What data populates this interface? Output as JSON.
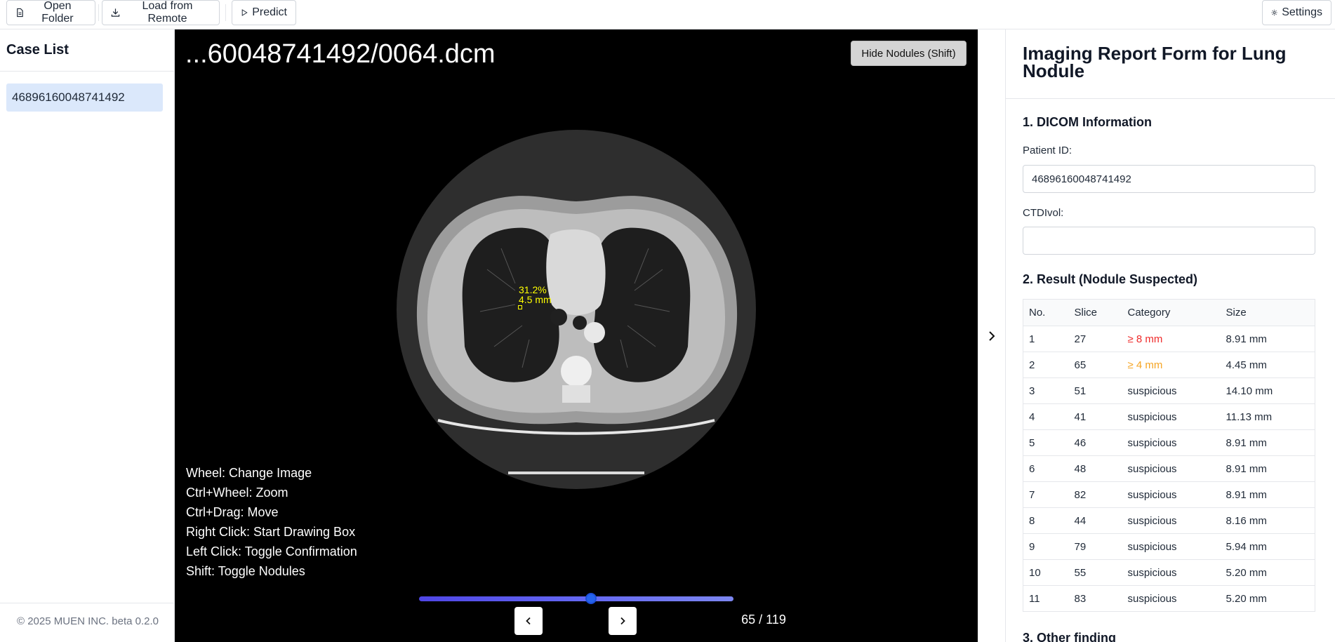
{
  "toolbar": {
    "open_folder": "Open Folder",
    "load_remote": "Load from Remote",
    "predict": "Predict",
    "settings": "Settings"
  },
  "sidebar": {
    "title": "Case List",
    "cases": [
      "46896160048741492"
    ],
    "footer": "© 2025 MUEN INC. beta 0.2.0"
  },
  "viewer": {
    "file_title": "...60048741492/0064.dcm",
    "hide_button": "Hide Nodules (Shift)",
    "annotation": {
      "percent": "31.2%",
      "size": "4.5 mm"
    },
    "help": [
      "Wheel: Change Image",
      "Ctrl+Wheel: Zoom",
      "Ctrl+Drag: Move",
      "Right Click: Start Drawing Box",
      "Left Click: Toggle Confirmation",
      "Shift: Toggle Nodules"
    ],
    "slider": {
      "current": 65,
      "total": 119,
      "fraction": 0.546
    },
    "counter": "65 / 119",
    "prev_icon": "chevron-left-icon",
    "next_icon": "chevron-right-icon"
  },
  "report": {
    "title": "Imaging Report Form for Lung Nodule",
    "section1": "1. DICOM Information",
    "patient_id_label": "Patient ID:",
    "patient_id_value": "46896160048741492",
    "ctdi_label": "CTDIvol:",
    "ctdi_value": "",
    "section2": "2. Result (Nodule Suspected)",
    "table_headers": [
      "No.",
      "Slice",
      "Category",
      "Size"
    ],
    "rows": [
      {
        "no": "1",
        "slice": "27",
        "category": "≥ 8 mm",
        "size": "8.91 mm",
        "color": "#ef2b2b"
      },
      {
        "no": "2",
        "slice": "65",
        "category": "≥ 4 mm",
        "size": "4.45 mm",
        "color": "#f5a524"
      },
      {
        "no": "3",
        "slice": "51",
        "category": "suspicious",
        "size": "14.10 mm",
        "color": "#1f2937"
      },
      {
        "no": "4",
        "slice": "41",
        "category": "suspicious",
        "size": "11.13 mm",
        "color": "#1f2937"
      },
      {
        "no": "5",
        "slice": "46",
        "category": "suspicious",
        "size": "8.91 mm",
        "color": "#1f2937"
      },
      {
        "no": "6",
        "slice": "48",
        "category": "suspicious",
        "size": "8.91 mm",
        "color": "#1f2937"
      },
      {
        "no": "7",
        "slice": "82",
        "category": "suspicious",
        "size": "8.91 mm",
        "color": "#1f2937"
      },
      {
        "no": "8",
        "slice": "44",
        "category": "suspicious",
        "size": "8.16 mm",
        "color": "#1f2937"
      },
      {
        "no": "9",
        "slice": "79",
        "category": "suspicious",
        "size": "5.94 mm",
        "color": "#1f2937"
      },
      {
        "no": "10",
        "slice": "55",
        "category": "suspicious",
        "size": "5.20 mm",
        "color": "#1f2937"
      },
      {
        "no": "11",
        "slice": "83",
        "category": "suspicious",
        "size": "5.20 mm",
        "color": "#1f2937"
      }
    ],
    "section3": "3. Other finding"
  }
}
